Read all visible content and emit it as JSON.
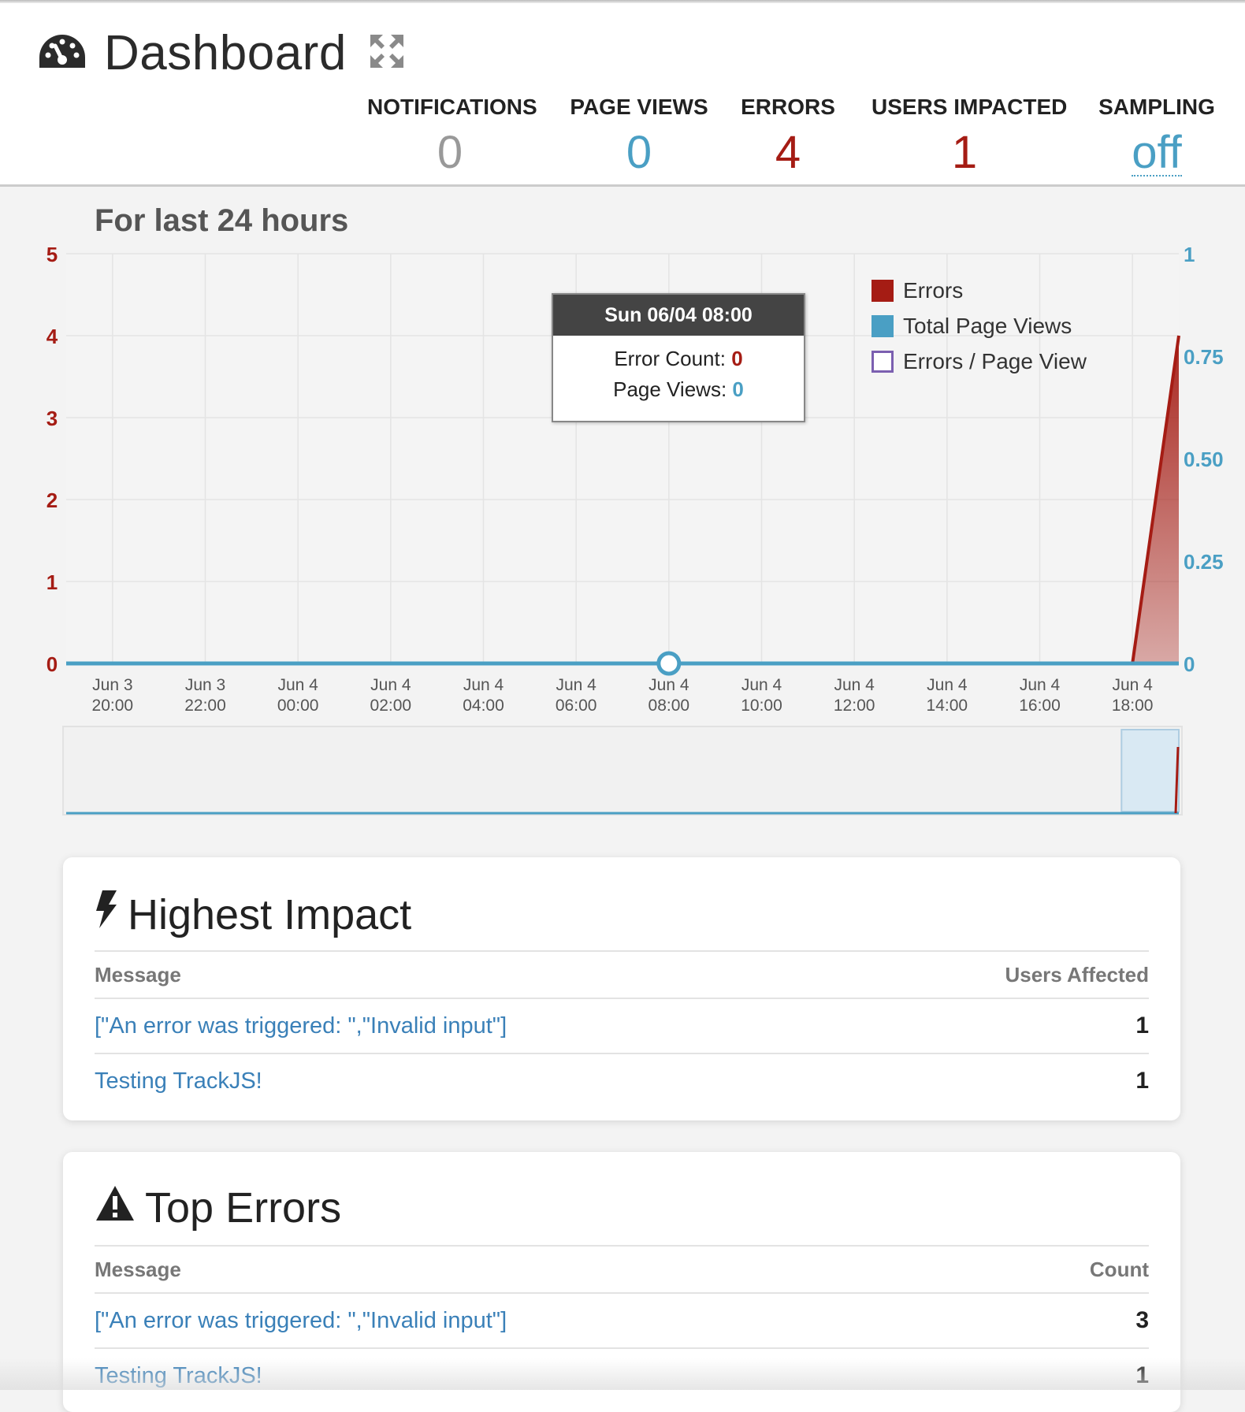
{
  "header": {
    "title": "Dashboard",
    "icons": {
      "dashboard": "dashboard-gauge-icon",
      "expand": "expand-arrows-icon"
    },
    "stats": [
      {
        "label": "NOTIFICATIONS",
        "value": "0",
        "color": "#999999"
      },
      {
        "label": "PAGE VIEWS",
        "value": "0",
        "color": "#4a9fc4"
      },
      {
        "label": "ERRORS",
        "value": "4",
        "color": "#a51c14"
      },
      {
        "label": "USERS IMPACTED",
        "value": "1",
        "color": "#a51c14"
      },
      {
        "label": "SAMPLING",
        "value": "off",
        "color": "#4a9fc4"
      }
    ]
  },
  "period_title": "For last 24 hours",
  "colors": {
    "errors": "#a51c14",
    "page_views": "#4a9fc4",
    "errors_per_view": "#7b5fb0"
  },
  "chart_data": {
    "type": "area",
    "x_ticks": [
      [
        "Jun 3",
        "20:00"
      ],
      [
        "Jun 3",
        "22:00"
      ],
      [
        "Jun 4",
        "00:00"
      ],
      [
        "Jun 4",
        "02:00"
      ],
      [
        "Jun 4",
        "04:00"
      ],
      [
        "Jun 4",
        "06:00"
      ],
      [
        "Jun 4",
        "08:00"
      ],
      [
        "Jun 4",
        "10:00"
      ],
      [
        "Jun 4",
        "12:00"
      ],
      [
        "Jun 4",
        "14:00"
      ],
      [
        "Jun 4",
        "16:00"
      ],
      [
        "Jun 4",
        "18:00"
      ]
    ],
    "x_hours": [
      0,
      2,
      4,
      6,
      8,
      10,
      12,
      14,
      16,
      18,
      20,
      22
    ],
    "x_range_hours": [
      -1,
      23
    ],
    "y_left": {
      "ticks": [
        "0",
        "1",
        "2",
        "3",
        "4",
        "5"
      ],
      "range": [
        0,
        5
      ]
    },
    "y_right": {
      "ticks": [
        "0",
        "0.25",
        "0.50",
        "0.75",
        "1"
      ],
      "range": [
        0,
        1
      ]
    },
    "series": [
      {
        "name": "Errors",
        "axis": "left",
        "points": [
          [
            -1,
            0
          ],
          [
            22,
            0
          ],
          [
            23,
            4
          ]
        ]
      },
      {
        "name": "Total Page Views",
        "axis": "right",
        "points": [
          [
            -1,
            0
          ],
          [
            23,
            0
          ]
        ]
      }
    ],
    "hover_point_hour": 12,
    "legend": [
      "Errors",
      "Total Page Views",
      "Errors / Page View"
    ],
    "legend_position": "top-right",
    "grid": true
  },
  "tooltip": {
    "header": "Sun 06/04 08:00",
    "error_label": "Error Count:",
    "error_value": "0",
    "pv_label": "Page Views:",
    "pv_value": "0"
  },
  "highest_impact": {
    "title": "Highest Impact",
    "icon": "lightning-bolt-icon",
    "col_message": "Message",
    "col_value": "Users Affected",
    "rows": [
      {
        "message": "[\"An error was triggered: \",\"Invalid input\"]",
        "value": "1"
      },
      {
        "message": "Testing TrackJS!",
        "value": "1"
      }
    ]
  },
  "top_errors": {
    "title": "Top Errors",
    "icon": "warning-triangle-icon",
    "col_message": "Message",
    "col_value": "Count",
    "rows": [
      {
        "message": "[\"An error was triggered: \",\"Invalid input\"]",
        "value": "3"
      },
      {
        "message": "Testing TrackJS!",
        "value": "1"
      }
    ]
  }
}
